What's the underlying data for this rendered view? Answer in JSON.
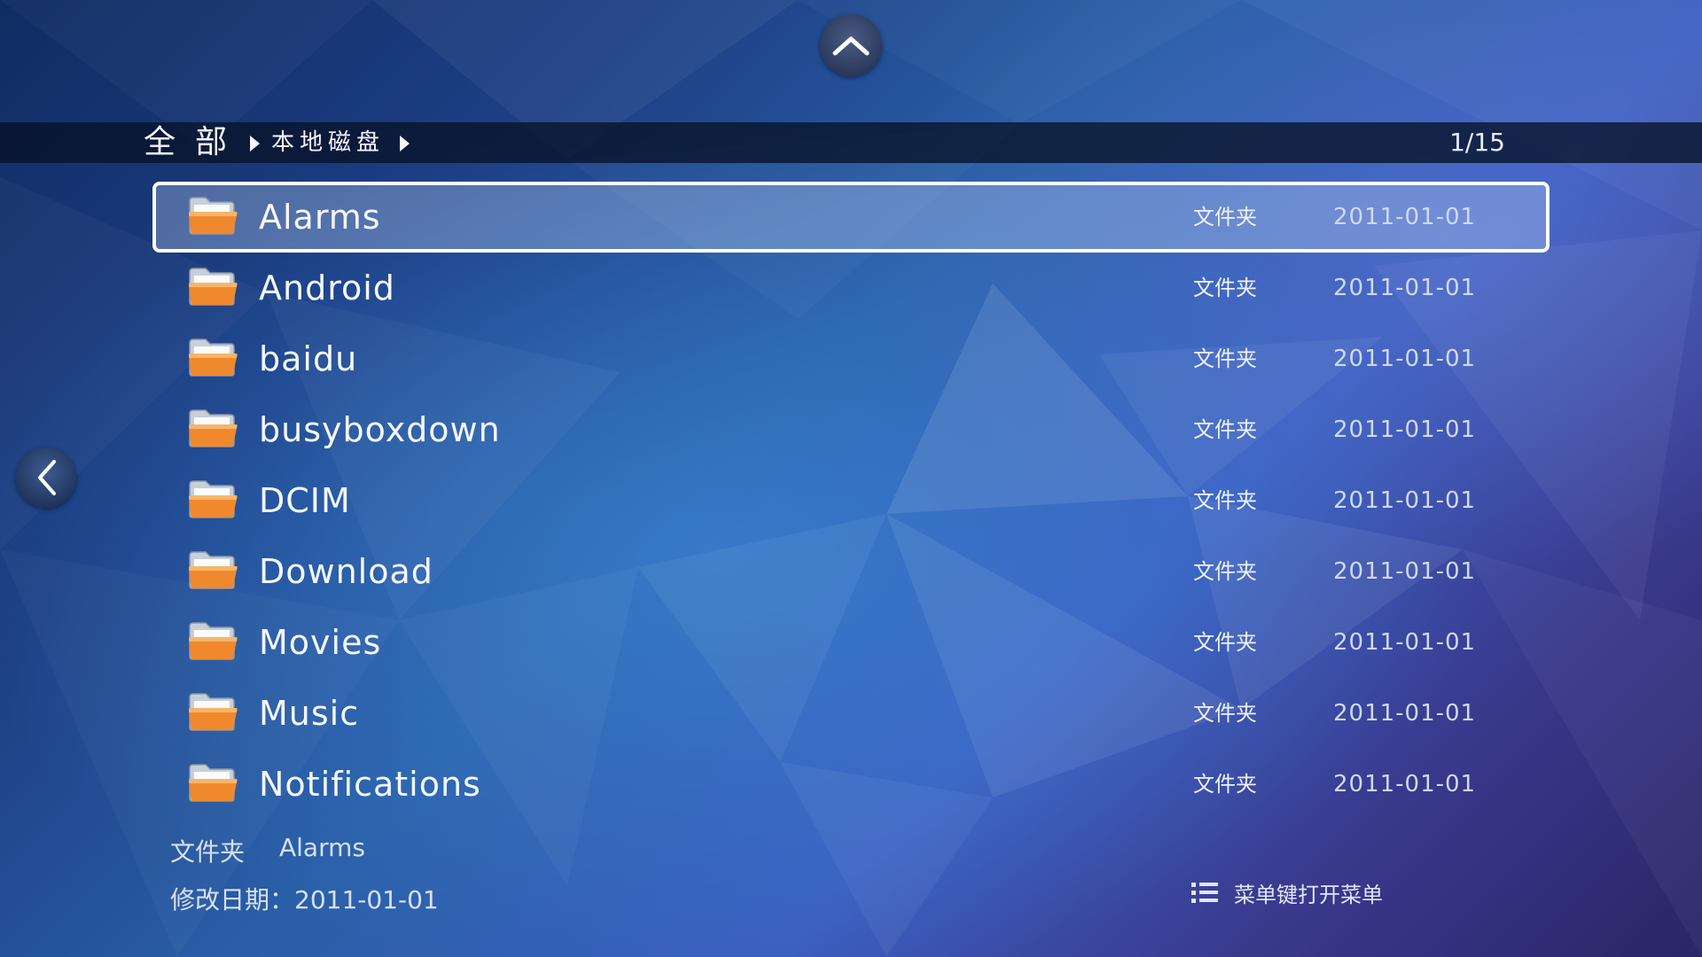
{
  "breadcrumb": {
    "root": "全部",
    "current": "本地磁盘"
  },
  "pagination": "1/15",
  "files": [
    {
      "name": "Alarms",
      "type": "文件夹",
      "date": "2011-01-01",
      "selected": true
    },
    {
      "name": "Android",
      "type": "文件夹",
      "date": "2011-01-01",
      "selected": false
    },
    {
      "name": "baidu",
      "type": "文件夹",
      "date": "2011-01-01",
      "selected": false
    },
    {
      "name": "busyboxdown",
      "type": "文件夹",
      "date": "2011-01-01",
      "selected": false
    },
    {
      "name": "DCIM",
      "type": "文件夹",
      "date": "2011-01-01",
      "selected": false
    },
    {
      "name": "Download",
      "type": "文件夹",
      "date": "2011-01-01",
      "selected": false
    },
    {
      "name": "Movies",
      "type": "文件夹",
      "date": "2011-01-01",
      "selected": false
    },
    {
      "name": "Music",
      "type": "文件夹",
      "date": "2011-01-01",
      "selected": false
    },
    {
      "name": "Notifications",
      "type": "文件夹",
      "date": "2011-01-01",
      "selected": false
    }
  ],
  "info": {
    "type": "文件夹",
    "name": "Alarms",
    "modified": "修改日期：2011-01-01"
  },
  "menu_hint": "菜单键打开菜单",
  "icons": {
    "up": "chevron-up-icon",
    "back": "chevron-left-icon",
    "folder": "folder-icon",
    "menu": "list-menu-icon"
  },
  "colors": {
    "selection_border": "#ffffff",
    "folder_orange": "#f0892e",
    "breadcrumb_bar": "#081228"
  }
}
